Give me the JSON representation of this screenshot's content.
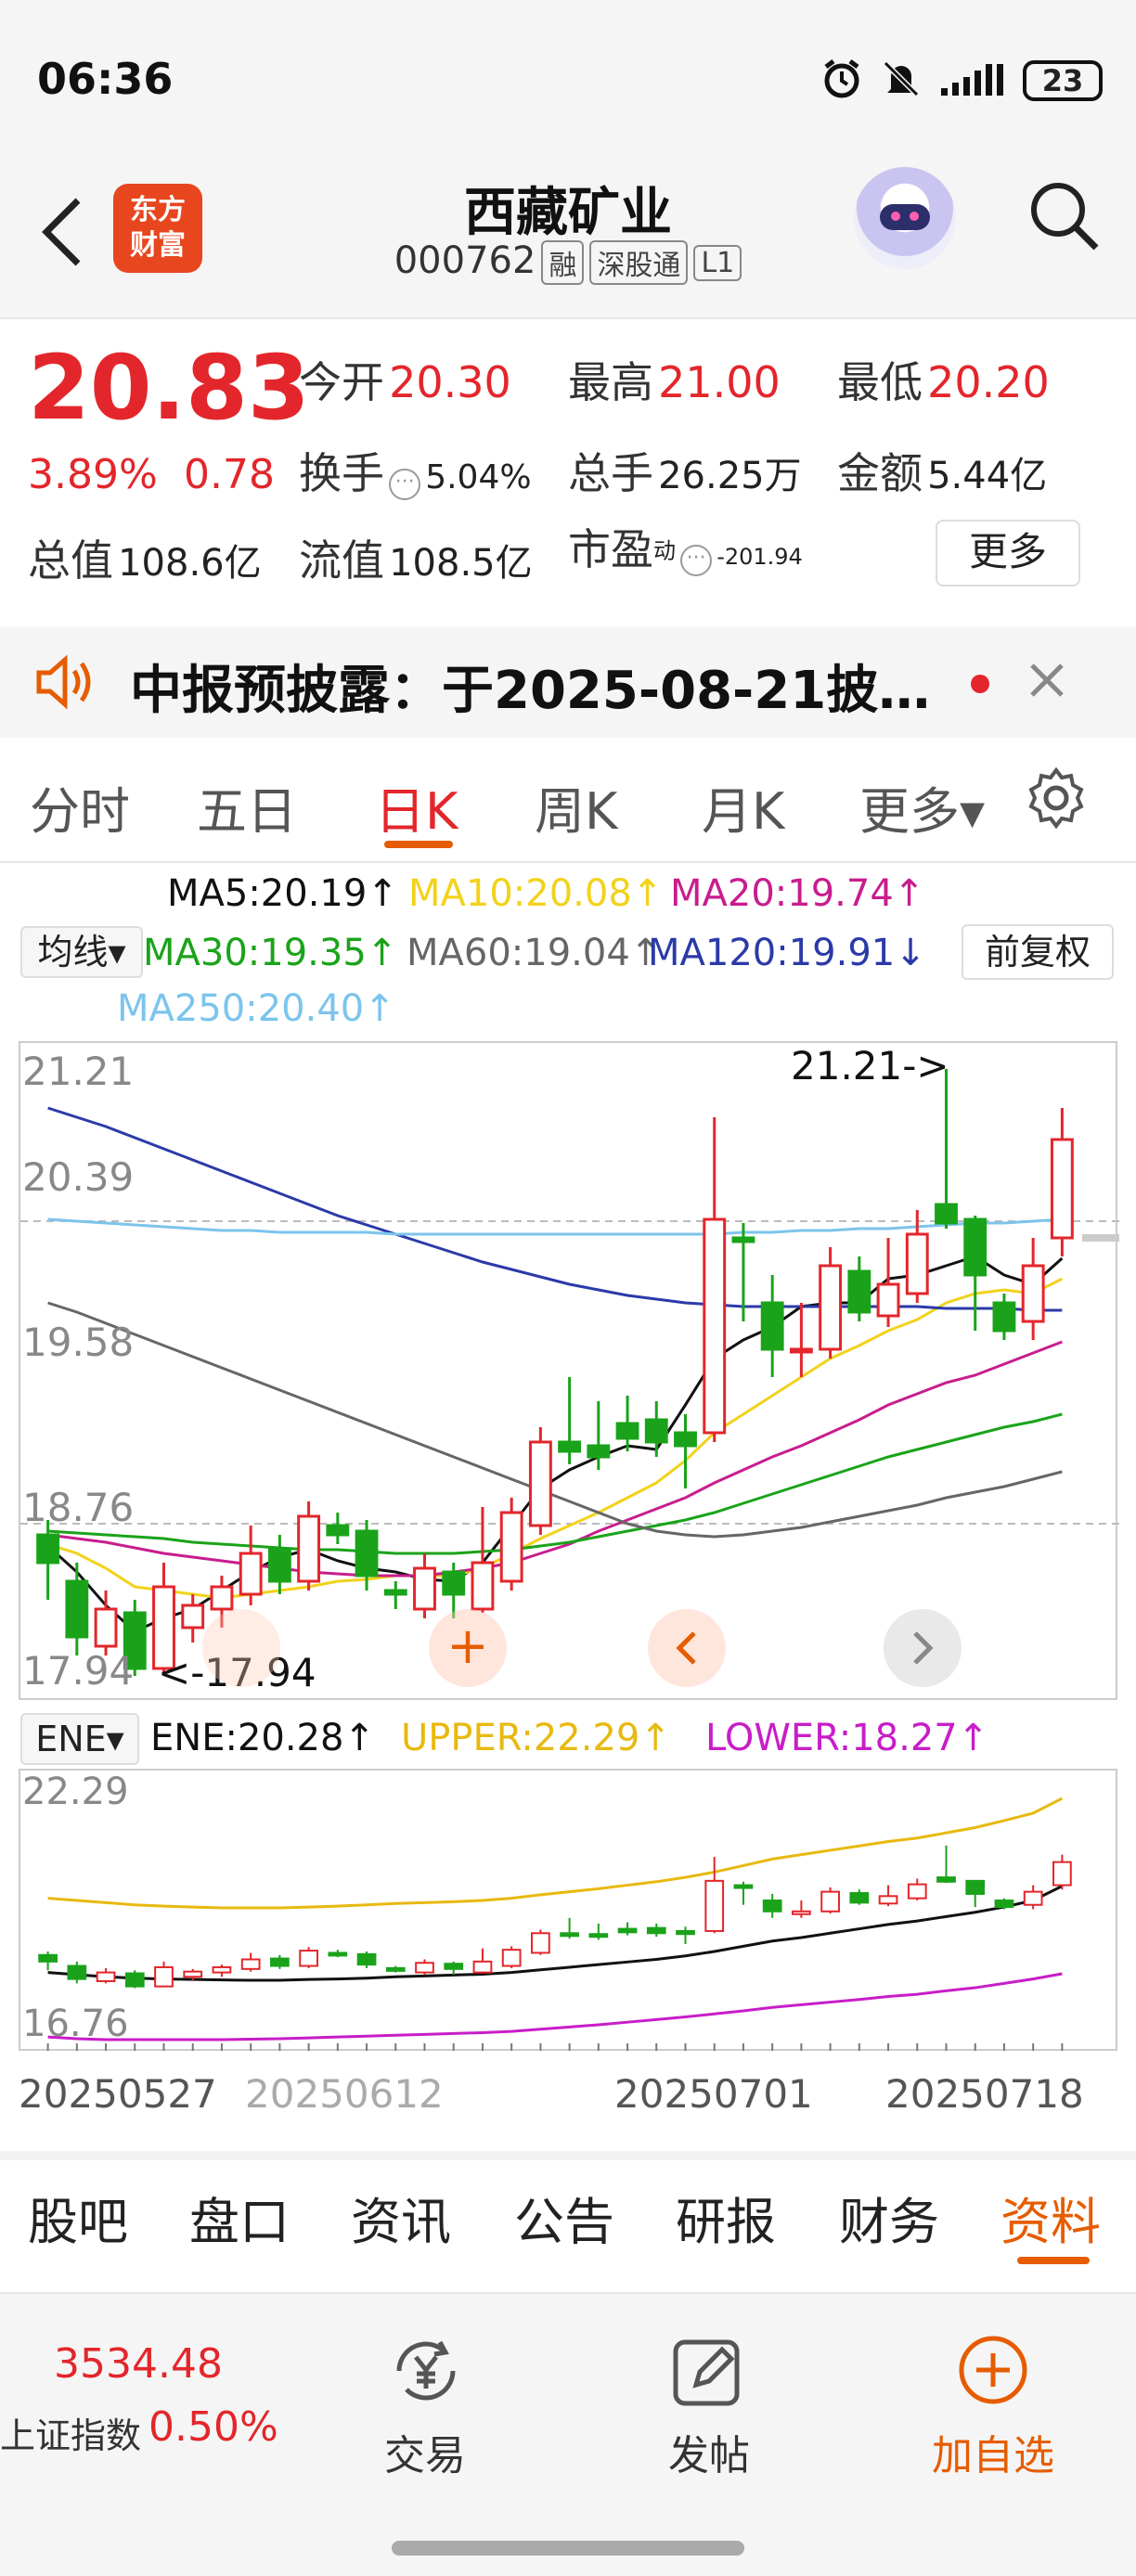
{
  "status_bar": {
    "time": "06:36",
    "battery": "23"
  },
  "header": {
    "logo_text_1": "东方",
    "logo_text_2": "财富",
    "stock_name": "西藏矿业",
    "stock_code": "000762",
    "tags": [
      "融",
      "深股通",
      "L1"
    ]
  },
  "quote": {
    "price": "20.83",
    "change_pct": "3.89%",
    "change": "0.78",
    "open_label": "今开",
    "open": "20.30",
    "high_label": "最高",
    "high": "21.00",
    "low_label": "最低",
    "low": "20.20",
    "turnover_label": "换手",
    "turnover": "5.04%",
    "volume_label": "总手",
    "volume": "26.25万",
    "amount_label": "金额",
    "amount": "5.44亿",
    "mktcap_label": "总值",
    "mktcap": "108.6亿",
    "float_label": "流值",
    "float": "108.5亿",
    "pe_label": "市盈",
    "pe_sup": "动",
    "pe": "-201.94",
    "more": "更多"
  },
  "notice": {
    "text": "中报预披露：于2025-08-21披…"
  },
  "kline_tabs": [
    {
      "label": "分时"
    },
    {
      "label": "五日"
    },
    {
      "label": "日K"
    },
    {
      "label": "周K"
    },
    {
      "label": "月K"
    },
    {
      "label": "更多▾"
    }
  ],
  "ma_legend": {
    "ma5": "MA5:20.19↑",
    "ma10": "MA10:20.08↑",
    "ma20": "MA20:19.74↑",
    "selector": "均线▾",
    "ma30": "MA30:19.35↑",
    "ma60": "MA60:19.04↑",
    "ma120": "MA120:19.91↓",
    "adjust": "前复权",
    "ma250": "MA250:20.40↑"
  },
  "price_axis": [
    "21.21",
    "20.39",
    "19.58",
    "18.76",
    "17.94"
  ],
  "annotations": {
    "high_mark": "21.21->",
    "low_mark": "<-17.94"
  },
  "ene_legend": {
    "selector": "ENE▾",
    "ene": "ENE:20.28↑",
    "upper": "UPPER:22.29↑",
    "lower": "LOWER:18.27↑"
  },
  "ene_axis": [
    "22.29",
    "16.76"
  ],
  "date_labels": [
    "20250527",
    "20250612",
    "20250701",
    "20250718"
  ],
  "bottom_tabs": [
    {
      "label": "股吧"
    },
    {
      "label": "盘口"
    },
    {
      "label": "资讯"
    },
    {
      "label": "公告"
    },
    {
      "label": "研报"
    },
    {
      "label": "财务"
    },
    {
      "label": "资料"
    }
  ],
  "bottom_nav": {
    "index_value": "3534.48",
    "index_name": "上证指数",
    "index_change": "0.50%",
    "trade": "交易",
    "post": "发帖",
    "add": "加自选"
  },
  "colors": {
    "up": "#e3262b",
    "down": "#1aa31a",
    "accent": "#e65c00",
    "ma5": "#111111",
    "ma10": "#f2d21b",
    "ma20": "#c81d8e",
    "ma30": "#1aa31a",
    "ma60": "#666666",
    "ma120": "#2b3aa8",
    "ma250": "#7cc4ec"
  },
  "chart_data": {
    "type": "candlestick",
    "y_range": [
      17.94,
      21.21
    ],
    "candles": [
      {
        "o": 18.7,
        "c": 18.55,
        "h": 18.78,
        "l": 18.35
      },
      {
        "o": 18.45,
        "c": 18.15,
        "h": 18.55,
        "l": 18.05
      },
      {
        "o": 18.1,
        "c": 18.3,
        "h": 18.4,
        "l": 18.05
      },
      {
        "o": 18.28,
        "c": 17.98,
        "h": 18.35,
        "l": 17.94
      },
      {
        "o": 17.98,
        "c": 18.42,
        "h": 18.55,
        "l": 17.96
      },
      {
        "o": 18.2,
        "c": 18.32,
        "h": 18.38,
        "l": 18.12
      },
      {
        "o": 18.3,
        "c": 18.42,
        "h": 18.48,
        "l": 18.2
      },
      {
        "o": 18.38,
        "c": 18.6,
        "h": 18.75,
        "l": 18.32
      },
      {
        "o": 18.62,
        "c": 18.45,
        "h": 18.7,
        "l": 18.38
      },
      {
        "o": 18.45,
        "c": 18.8,
        "h": 18.88,
        "l": 18.4
      },
      {
        "o": 18.75,
        "c": 18.7,
        "h": 18.82,
        "l": 18.65
      },
      {
        "o": 18.72,
        "c": 18.48,
        "h": 18.78,
        "l": 18.4
      },
      {
        "o": 18.4,
        "c": 18.38,
        "h": 18.45,
        "l": 18.3
      },
      {
        "o": 18.3,
        "c": 18.52,
        "h": 18.6,
        "l": 18.25
      },
      {
        "o": 18.5,
        "c": 18.38,
        "h": 18.55,
        "l": 18.25
      },
      {
        "o": 18.3,
        "c": 18.55,
        "h": 18.85,
        "l": 18.28
      },
      {
        "o": 18.45,
        "c": 18.82,
        "h": 18.9,
        "l": 18.4
      },
      {
        "o": 18.75,
        "c": 19.2,
        "h": 19.28,
        "l": 18.7
      },
      {
        "o": 19.2,
        "c": 19.15,
        "h": 19.55,
        "l": 19.08
      },
      {
        "o": 19.18,
        "c": 19.12,
        "h": 19.42,
        "l": 19.05
      },
      {
        "o": 19.3,
        "c": 19.22,
        "h": 19.45,
        "l": 19.15
      },
      {
        "o": 19.32,
        "c": 19.2,
        "h": 19.42,
        "l": 19.12
      },
      {
        "o": 19.25,
        "c": 19.18,
        "h": 19.35,
        "l": 18.95
      },
      {
        "o": 19.25,
        "c": 20.4,
        "h": 20.95,
        "l": 19.2
      },
      {
        "o": 20.3,
        "c": 20.28,
        "h": 20.38,
        "l": 19.85
      },
      {
        "o": 19.95,
        "c": 19.7,
        "h": 20.1,
        "l": 19.55
      },
      {
        "o": 19.7,
        "c": 19.7,
        "h": 19.95,
        "l": 19.55
      },
      {
        "o": 19.7,
        "c": 20.15,
        "h": 20.25,
        "l": 19.65
      },
      {
        "o": 20.12,
        "c": 19.9,
        "h": 20.2,
        "l": 19.85
      },
      {
        "o": 19.88,
        "c": 20.05,
        "h": 20.3,
        "l": 19.82
      },
      {
        "o": 20.0,
        "c": 20.32,
        "h": 20.45,
        "l": 19.95
      },
      {
        "o": 20.48,
        "c": 20.38,
        "h": 21.21,
        "l": 20.35
      },
      {
        "o": 20.4,
        "c": 20.1,
        "h": 20.42,
        "l": 19.8
      },
      {
        "o": 19.95,
        "c": 19.8,
        "h": 20.0,
        "l": 19.75
      },
      {
        "o": 19.85,
        "c": 20.15,
        "h": 20.3,
        "l": 19.75
      },
      {
        "o": 20.3,
        "c": 20.83,
        "h": 21.0,
        "l": 20.2
      }
    ],
    "ma_lines": {
      "MA5": [
        18.64,
        18.5,
        18.32,
        18.18,
        18.25,
        18.3,
        18.4,
        18.5,
        18.58,
        18.62,
        18.56,
        18.52,
        18.5,
        18.46,
        18.45,
        18.55,
        18.75,
        18.95,
        19.05,
        19.12,
        19.18,
        19.16,
        19.4,
        19.65,
        19.75,
        19.82,
        19.93,
        19.95,
        19.95,
        20.08,
        20.1,
        20.15,
        20.2,
        20.1,
        20.05,
        20.19
      ],
      "MA10": [
        18.65,
        18.6,
        18.52,
        18.42,
        18.4,
        18.38,
        18.36,
        18.38,
        18.4,
        18.42,
        18.45,
        18.46,
        18.48,
        18.48,
        18.48,
        18.52,
        18.6,
        18.68,
        18.75,
        18.82,
        18.9,
        18.98,
        19.1,
        19.25,
        19.35,
        19.45,
        19.55,
        19.65,
        19.72,
        19.8,
        19.86,
        19.95,
        20.0,
        20.02,
        20.0,
        20.08
      ],
      "MA20": [
        18.7,
        18.68,
        18.66,
        18.63,
        18.6,
        18.58,
        18.56,
        18.54,
        18.52,
        18.5,
        18.49,
        18.48,
        18.48,
        18.48,
        18.5,
        18.52,
        18.55,
        18.6,
        18.65,
        18.72,
        18.78,
        18.84,
        18.9,
        18.98,
        19.05,
        19.12,
        19.18,
        19.25,
        19.32,
        19.4,
        19.46,
        19.52,
        19.56,
        19.62,
        19.68,
        19.74
      ],
      "MA30": [
        18.72,
        18.71,
        18.7,
        18.69,
        18.68,
        18.66,
        18.65,
        18.64,
        18.63,
        18.62,
        18.62,
        18.61,
        18.6,
        18.6,
        18.6,
        18.61,
        18.62,
        18.64,
        18.66,
        18.69,
        18.72,
        18.75,
        18.78,
        18.82,
        18.87,
        18.92,
        18.97,
        19.02,
        19.07,
        19.12,
        19.16,
        19.2,
        19.24,
        19.28,
        19.31,
        19.35
      ],
      "MA60": [
        19.95,
        19.9,
        19.84,
        19.78,
        19.72,
        19.66,
        19.6,
        19.54,
        19.48,
        19.42,
        19.36,
        19.3,
        19.24,
        19.18,
        19.12,
        19.06,
        19.0,
        18.94,
        18.88,
        18.82,
        18.76,
        18.72,
        18.7,
        18.69,
        18.7,
        18.72,
        18.74,
        18.77,
        18.8,
        18.83,
        18.86,
        18.9,
        18.93,
        18.96,
        19.0,
        19.04
      ],
      "MA120": [
        21.0,
        20.95,
        20.9,
        20.84,
        20.78,
        20.72,
        20.66,
        20.6,
        20.54,
        20.48,
        20.42,
        20.37,
        20.32,
        20.27,
        20.22,
        20.17,
        20.13,
        20.09,
        20.05,
        20.02,
        19.99,
        19.97,
        19.95,
        19.94,
        19.93,
        19.93,
        19.93,
        19.93,
        19.93,
        19.93,
        19.93,
        19.92,
        19.92,
        19.92,
        19.91,
        19.91
      ],
      "MA250": [
        20.4,
        20.39,
        20.38,
        20.37,
        20.36,
        20.35,
        20.34,
        20.34,
        20.33,
        20.33,
        20.33,
        20.33,
        20.32,
        20.32,
        20.32,
        20.32,
        20.32,
        20.32,
        20.32,
        20.32,
        20.32,
        20.32,
        20.32,
        20.32,
        20.33,
        20.33,
        20.34,
        20.34,
        20.35,
        20.35,
        20.36,
        20.37,
        20.38,
        20.38,
        20.39,
        20.4
      ]
    },
    "ene": {
      "y_range": [
        16.76,
        22.29
      ],
      "upper": [
        20.0,
        19.95,
        19.9,
        19.85,
        19.82,
        19.8,
        19.78,
        19.78,
        19.78,
        19.8,
        19.82,
        19.85,
        19.88,
        19.9,
        19.92,
        19.95,
        20.0,
        20.08,
        20.15,
        20.22,
        20.3,
        20.38,
        20.48,
        20.6,
        20.75,
        20.9,
        21.0,
        21.1,
        21.2,
        21.3,
        21.38,
        21.5,
        21.62,
        21.78,
        21.95,
        22.29
      ],
      "ene": [
        18.3,
        18.25,
        18.2,
        18.17,
        18.15,
        18.14,
        18.13,
        18.12,
        18.12,
        18.14,
        18.15,
        18.17,
        18.2,
        18.22,
        18.24,
        18.26,
        18.3,
        18.36,
        18.42,
        18.48,
        18.54,
        18.6,
        18.68,
        18.78,
        18.9,
        19.02,
        19.1,
        19.2,
        19.3,
        19.4,
        19.48,
        19.58,
        19.68,
        19.8,
        19.95,
        20.28
      ],
      "lower": [
        16.82,
        16.78,
        16.76,
        16.76,
        16.76,
        16.76,
        16.76,
        16.77,
        16.78,
        16.8,
        16.82,
        16.84,
        16.86,
        16.88,
        16.9,
        16.92,
        16.95,
        17.0,
        17.05,
        17.1,
        17.16,
        17.22,
        17.28,
        17.35,
        17.42,
        17.5,
        17.56,
        17.62,
        17.68,
        17.75,
        17.8,
        17.88,
        17.95,
        18.05,
        18.15,
        18.27
      ]
    }
  }
}
